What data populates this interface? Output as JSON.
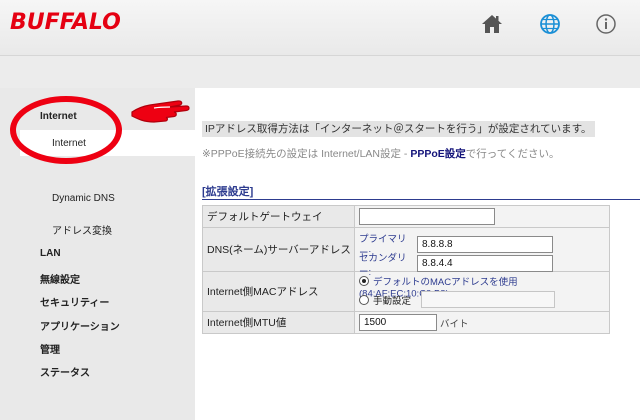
{
  "header": {
    "logo": "BUFFALO",
    "icons": [
      "home-icon",
      "globe-icon",
      "info-icon"
    ]
  },
  "sidebar": {
    "section": "Internet",
    "active_sub": "Internet",
    "sub_items": [
      "Dynamic DNS",
      "アドレス変換"
    ],
    "items": [
      "LAN",
      "無線設定",
      "セキュリティー",
      "アプリケーション",
      "管理",
      "ステータス"
    ]
  },
  "main": {
    "note1": "IPアドレス取得方法は「インターネット＠スタートを行う」が設定されています。",
    "note2_prefix": "※PPPoE接続先の設定は Internet/LAN設定 - ",
    "note2_link": "PPPoE設定",
    "note2_suffix": "で行ってください。",
    "section_title": "[拡張設定]",
    "rows": {
      "gateway_label": "デフォルトゲートウェイ",
      "gateway_value": "",
      "dns_label": "DNS(ネーム)サーバーアドレス",
      "dns_primary_label": "プライマリー:",
      "dns_primary_value": "8.8.8.8",
      "dns_secondary_label": "セカンダリー:",
      "dns_secondary_value": "8.8.4.4",
      "mac_label": "Internet側MACアドレス",
      "mac_default_option": "デフォルトのMACアドレスを使用 (84:AF:EC:10:C3:B8)",
      "mac_manual_option": "手動設定",
      "mac_manual_value": "",
      "mtu_label": "Internet側MTU値",
      "mtu_value": "1500",
      "mtu_unit": "バイト"
    }
  },
  "colors": {
    "brand_red": "#e50012",
    "annotation_red": "#ee0012",
    "section_blue": "#2d3b8f"
  }
}
